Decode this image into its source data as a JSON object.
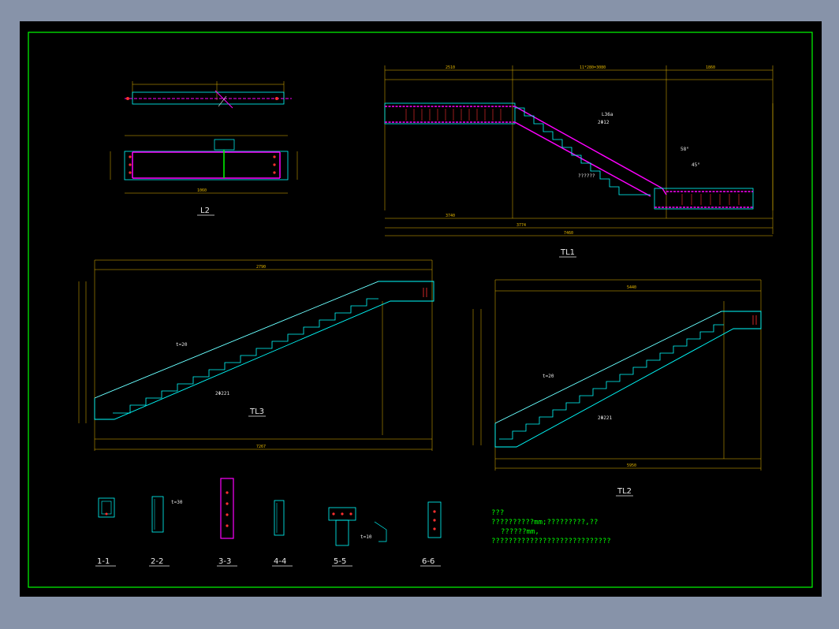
{
  "titles": {
    "l2": "L2",
    "tl1": "TL1",
    "tl3": "TL3",
    "tl2": "TL2",
    "s11": "1-1",
    "s22": "2-2",
    "s33": "3-3",
    "s44": "4-4",
    "s55": "5-5",
    "s66": "6-6"
  },
  "annotations": {
    "angle1": "58°",
    "angle2": "45°",
    "tl1_a": "L36a",
    "tl1_b": "2Φ12",
    "tl3_t": "t=20",
    "tl3_r": "2Φ221",
    "tl2_t": "t=20",
    "tl2_r": "2Φ221",
    "sec22_t": "t=30",
    "sec55_t": "t=10",
    "tl1_num": "??????"
  },
  "notes": {
    "heading": "???",
    "line1": "??????????mm;?????????,??",
    "line2": "??????mm,",
    "line3": "????????????????????????????"
  },
  "dims": {
    "d1": "2510",
    "d2": "11*280=3080",
    "d3": "1860",
    "d4": "3740",
    "d5": "3774",
    "d6": "1060",
    "d7": "1450",
    "d8": "1450",
    "d9": "7460",
    "d10": "5440",
    "d11": "2790",
    "d12": "7267",
    "d13": "5950"
  },
  "colors": {
    "background": "#000000",
    "frame": "#00ff00",
    "magenta": "#ff00ff",
    "cyan": "#00ffff",
    "dimension": "#e6b800",
    "text": "#e8e8e8",
    "red": "#ff3030"
  }
}
